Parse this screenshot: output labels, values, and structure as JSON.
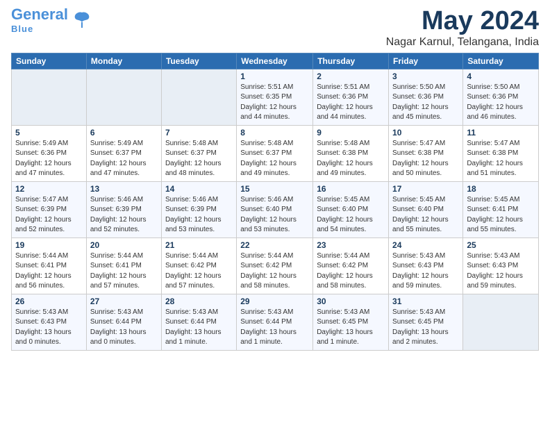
{
  "header": {
    "logo_line1": "General",
    "logo_line2": "Blue",
    "main_title": "May 2024",
    "subtitle": "Nagar Karnul, Telangana, India"
  },
  "calendar": {
    "headers": [
      "Sunday",
      "Monday",
      "Tuesday",
      "Wednesday",
      "Thursday",
      "Friday",
      "Saturday"
    ],
    "weeks": [
      [
        {
          "day": "",
          "info": ""
        },
        {
          "day": "",
          "info": ""
        },
        {
          "day": "",
          "info": ""
        },
        {
          "day": "1",
          "info": "Sunrise: 5:51 AM\nSunset: 6:35 PM\nDaylight: 12 hours\nand 44 minutes."
        },
        {
          "day": "2",
          "info": "Sunrise: 5:51 AM\nSunset: 6:36 PM\nDaylight: 12 hours\nand 44 minutes."
        },
        {
          "day": "3",
          "info": "Sunrise: 5:50 AM\nSunset: 6:36 PM\nDaylight: 12 hours\nand 45 minutes."
        },
        {
          "day": "4",
          "info": "Sunrise: 5:50 AM\nSunset: 6:36 PM\nDaylight: 12 hours\nand 46 minutes."
        }
      ],
      [
        {
          "day": "5",
          "info": "Sunrise: 5:49 AM\nSunset: 6:36 PM\nDaylight: 12 hours\nand 47 minutes."
        },
        {
          "day": "6",
          "info": "Sunrise: 5:49 AM\nSunset: 6:37 PM\nDaylight: 12 hours\nand 47 minutes."
        },
        {
          "day": "7",
          "info": "Sunrise: 5:48 AM\nSunset: 6:37 PM\nDaylight: 12 hours\nand 48 minutes."
        },
        {
          "day": "8",
          "info": "Sunrise: 5:48 AM\nSunset: 6:37 PM\nDaylight: 12 hours\nand 49 minutes."
        },
        {
          "day": "9",
          "info": "Sunrise: 5:48 AM\nSunset: 6:38 PM\nDaylight: 12 hours\nand 49 minutes."
        },
        {
          "day": "10",
          "info": "Sunrise: 5:47 AM\nSunset: 6:38 PM\nDaylight: 12 hours\nand 50 minutes."
        },
        {
          "day": "11",
          "info": "Sunrise: 5:47 AM\nSunset: 6:38 PM\nDaylight: 12 hours\nand 51 minutes."
        }
      ],
      [
        {
          "day": "12",
          "info": "Sunrise: 5:47 AM\nSunset: 6:39 PM\nDaylight: 12 hours\nand 52 minutes."
        },
        {
          "day": "13",
          "info": "Sunrise: 5:46 AM\nSunset: 6:39 PM\nDaylight: 12 hours\nand 52 minutes."
        },
        {
          "day": "14",
          "info": "Sunrise: 5:46 AM\nSunset: 6:39 PM\nDaylight: 12 hours\nand 53 minutes."
        },
        {
          "day": "15",
          "info": "Sunrise: 5:46 AM\nSunset: 6:40 PM\nDaylight: 12 hours\nand 53 minutes."
        },
        {
          "day": "16",
          "info": "Sunrise: 5:45 AM\nSunset: 6:40 PM\nDaylight: 12 hours\nand 54 minutes."
        },
        {
          "day": "17",
          "info": "Sunrise: 5:45 AM\nSunset: 6:40 PM\nDaylight: 12 hours\nand 55 minutes."
        },
        {
          "day": "18",
          "info": "Sunrise: 5:45 AM\nSunset: 6:41 PM\nDaylight: 12 hours\nand 55 minutes."
        }
      ],
      [
        {
          "day": "19",
          "info": "Sunrise: 5:44 AM\nSunset: 6:41 PM\nDaylight: 12 hours\nand 56 minutes."
        },
        {
          "day": "20",
          "info": "Sunrise: 5:44 AM\nSunset: 6:41 PM\nDaylight: 12 hours\nand 57 minutes."
        },
        {
          "day": "21",
          "info": "Sunrise: 5:44 AM\nSunset: 6:42 PM\nDaylight: 12 hours\nand 57 minutes."
        },
        {
          "day": "22",
          "info": "Sunrise: 5:44 AM\nSunset: 6:42 PM\nDaylight: 12 hours\nand 58 minutes."
        },
        {
          "day": "23",
          "info": "Sunrise: 5:44 AM\nSunset: 6:42 PM\nDaylight: 12 hours\nand 58 minutes."
        },
        {
          "day": "24",
          "info": "Sunrise: 5:43 AM\nSunset: 6:43 PM\nDaylight: 12 hours\nand 59 minutes."
        },
        {
          "day": "25",
          "info": "Sunrise: 5:43 AM\nSunset: 6:43 PM\nDaylight: 12 hours\nand 59 minutes."
        }
      ],
      [
        {
          "day": "26",
          "info": "Sunrise: 5:43 AM\nSunset: 6:43 PM\nDaylight: 13 hours\nand 0 minutes."
        },
        {
          "day": "27",
          "info": "Sunrise: 5:43 AM\nSunset: 6:44 PM\nDaylight: 13 hours\nand 0 minutes."
        },
        {
          "day": "28",
          "info": "Sunrise: 5:43 AM\nSunset: 6:44 PM\nDaylight: 13 hours\nand 1 minute."
        },
        {
          "day": "29",
          "info": "Sunrise: 5:43 AM\nSunset: 6:44 PM\nDaylight: 13 hours\nand 1 minute."
        },
        {
          "day": "30",
          "info": "Sunrise: 5:43 AM\nSunset: 6:45 PM\nDaylight: 13 hours\nand 1 minute."
        },
        {
          "day": "31",
          "info": "Sunrise: 5:43 AM\nSunset: 6:45 PM\nDaylight: 13 hours\nand 2 minutes."
        },
        {
          "day": "",
          "info": ""
        }
      ]
    ]
  }
}
